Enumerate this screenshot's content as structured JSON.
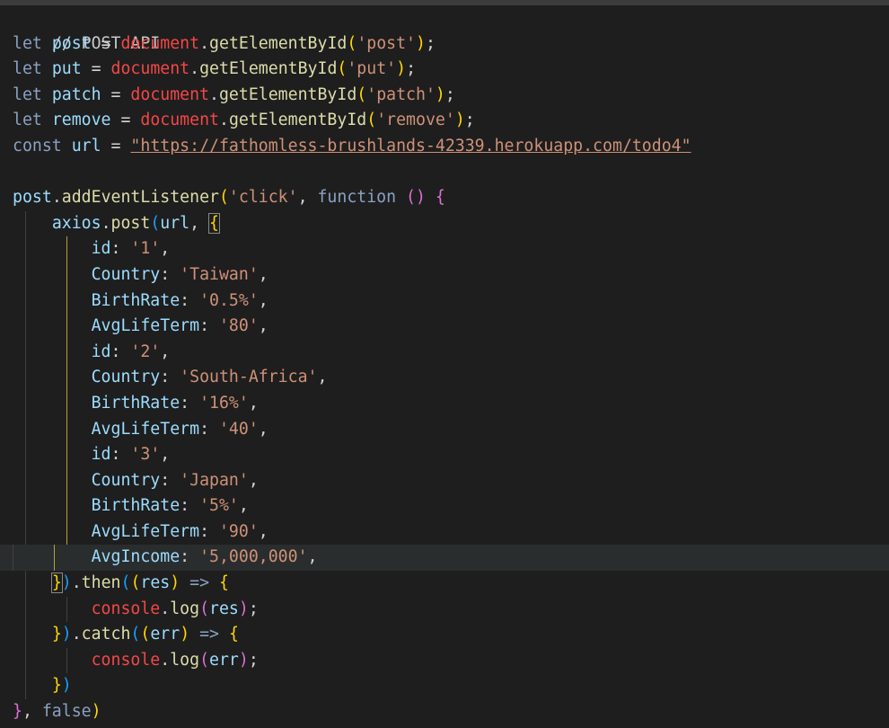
{
  "editor": {
    "lines": [
      "// POST API",
      "let post = document.getElementById('post');",
      "let put = document.getElementById('put');",
      "let patch = document.getElementById('patch');",
      "let remove = document.getElementById('remove');",
      "const url = \"https://fathomless-brushlands-42339.herokuapp.com/todo4\"",
      "",
      "post.addEventListener('click', function () {",
      "axios.post(url, {",
      "id: '1',",
      "Country: 'Taiwan',",
      "BirthRate: '0.5%',",
      "AvgLifeTerm: '80',",
      "id: '2',",
      "Country: 'South-Africa',",
      "BirthRate: '16%',",
      "AvgLifeTerm: '40',",
      "id: '3',",
      "Country: 'Japan',",
      "BirthRate: '5%',",
      "AvgLifeTerm: '90',",
      "AvgIncome: '5,000,000',",
      "}).then((res) => {",
      "console.log(res);",
      "}).catch((err) => {",
      "console.log(err);",
      "})",
      "}, false)"
    ]
  },
  "colors": {
    "background": "#1e1e1e",
    "string": "#ce9178",
    "keyword": "#569cd6",
    "variable": "#9cdcfe",
    "function": "#dcdcaa",
    "bracket_gold": "#ffd700",
    "bracket_purple": "#da70d6",
    "bracket_blue": "#179fff"
  }
}
